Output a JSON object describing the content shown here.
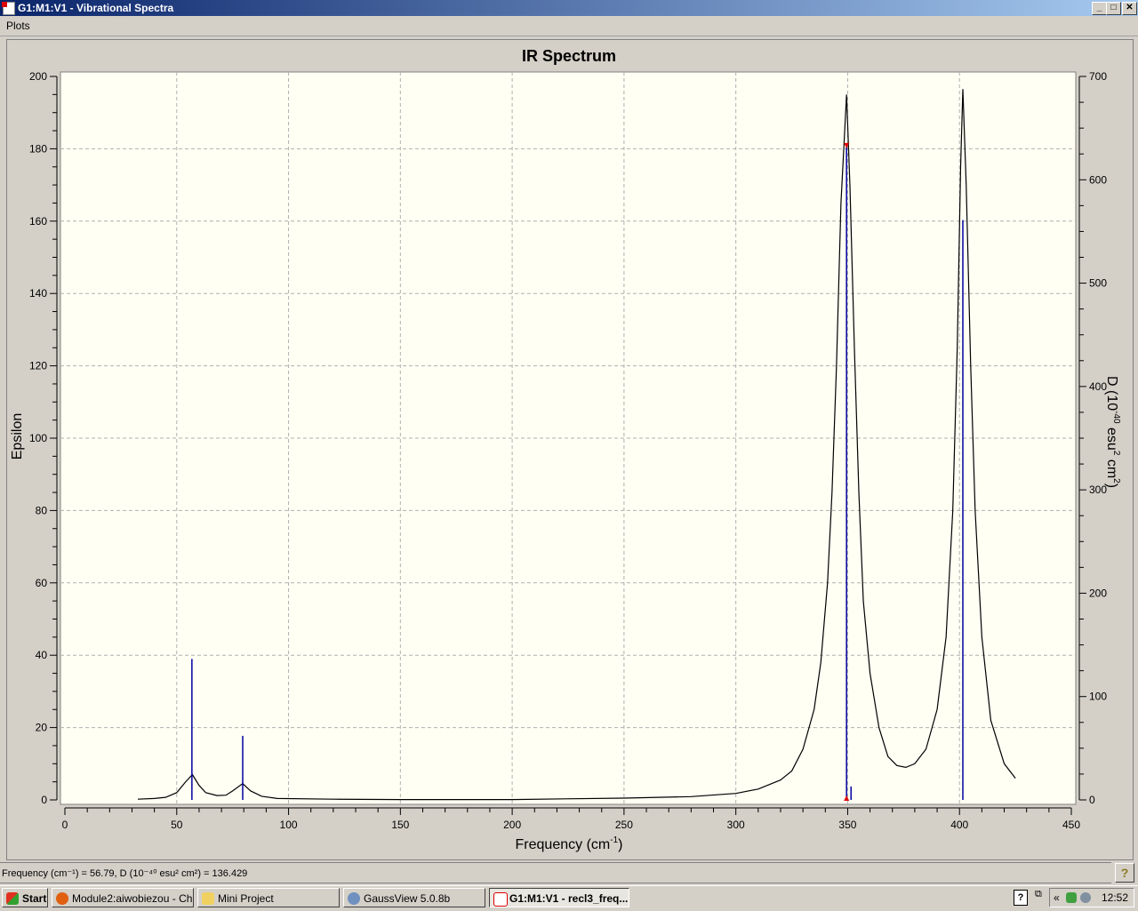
{
  "window": {
    "title": "G1:M1:V1 - Vibrational Spectra",
    "minimize": "_",
    "maximize": "□",
    "close": "✕"
  },
  "menu": {
    "plots": "Plots"
  },
  "status": {
    "text": "Frequency (cm⁻¹) = 56.79, D (10⁻⁴⁰ esu² cm²) = 136.429",
    "help": "?"
  },
  "taskbar": {
    "start": "Start",
    "items": [
      {
        "label": "Module2:aiwobiezou - Ch...",
        "icon": "firefox-icon",
        "color": "#e06010"
      },
      {
        "label": "Mini Project",
        "icon": "folder-icon",
        "color": "#f0d060"
      },
      {
        "label": "GaussView 5.0.8b",
        "icon": "gaussview-icon",
        "color": "#7090c0"
      },
      {
        "label": "G1:M1:V1 - recl3_freq...",
        "icon": "spectrum-icon",
        "color": "#d00000",
        "active": true
      }
    ],
    "tray_expand": "«",
    "clock": "12:52"
  },
  "colors": {
    "curve": "#000000",
    "sticks": "#0000a0",
    "marker": "#e00000",
    "plot_bg": "#fffff4",
    "grid": "#b0b0b0"
  },
  "chart_data": {
    "type": "line",
    "title": "IR Spectrum",
    "xlabel": "Frequency (cm",
    "xlabel_sup": "-1",
    "xlabel_end": ")",
    "ylabel": "Epsilon",
    "y2label": "D (10",
    "y2label_sup1": "-40",
    "y2label_mid": " esu",
    "y2label_sup2": "2",
    "y2label_mid2": " cm",
    "y2label_sup3": "2",
    "y2label_end": ")",
    "xlim": [
      0,
      450
    ],
    "ylim": [
      0,
      200
    ],
    "y2lim": [
      0,
      700
    ],
    "xticks": [
      0,
      50,
      100,
      150,
      200,
      250,
      300,
      350,
      400,
      450
    ],
    "yticks": [
      0,
      20,
      40,
      60,
      80,
      100,
      120,
      140,
      160,
      180,
      200
    ],
    "y2ticks": [
      0,
      100,
      200,
      300,
      400,
      500,
      600,
      700
    ],
    "grid": true,
    "sticks": [
      {
        "freq": 56.79,
        "D": 136.429
      },
      {
        "freq": 79.5,
        "D": 62
      },
      {
        "freq": 349.5,
        "D": 633
      },
      {
        "freq": 351.5,
        "D": 13
      },
      {
        "freq": 401.5,
        "D": 561
      }
    ],
    "selected_freq": 349.5,
    "spectrum": [
      [
        32.6,
        0.2
      ],
      [
        40,
        0.4
      ],
      [
        45,
        0.7
      ],
      [
        50,
        2
      ],
      [
        54,
        5
      ],
      [
        57,
        7
      ],
      [
        60,
        4
      ],
      [
        63,
        2
      ],
      [
        68,
        1.2
      ],
      [
        72,
        1.3
      ],
      [
        75,
        2.5
      ],
      [
        79.5,
        4.5
      ],
      [
        83,
        2.5
      ],
      [
        88,
        1
      ],
      [
        95,
        0.4
      ],
      [
        120,
        0.2
      ],
      [
        150,
        0.1
      ],
      [
        200,
        0.1
      ],
      [
        250,
        0.5
      ],
      [
        280,
        0.9
      ],
      [
        300,
        1.8
      ],
      [
        310,
        3
      ],
      [
        320,
        5.5
      ],
      [
        325,
        8
      ],
      [
        330,
        14
      ],
      [
        335,
        25
      ],
      [
        338,
        38
      ],
      [
        341,
        60
      ],
      [
        343,
        85
      ],
      [
        345,
        120
      ],
      [
        347,
        165
      ],
      [
        349.5,
        195
      ],
      [
        351,
        170
      ],
      [
        353,
        125
      ],
      [
        355,
        85
      ],
      [
        357,
        55
      ],
      [
        360,
        35
      ],
      [
        364,
        20
      ],
      [
        368,
        12
      ],
      [
        372,
        9.5
      ],
      [
        376,
        9
      ],
      [
        380,
        10
      ],
      [
        385,
        14
      ],
      [
        390,
        25
      ],
      [
        394,
        45
      ],
      [
        397,
        80
      ],
      [
        399,
        125
      ],
      [
        400.5,
        175
      ],
      [
        401.5,
        196.5
      ],
      [
        403,
        170
      ],
      [
        405,
        120
      ],
      [
        407,
        80
      ],
      [
        410,
        45
      ],
      [
        414,
        22
      ],
      [
        420,
        10
      ],
      [
        425,
        6
      ]
    ]
  }
}
